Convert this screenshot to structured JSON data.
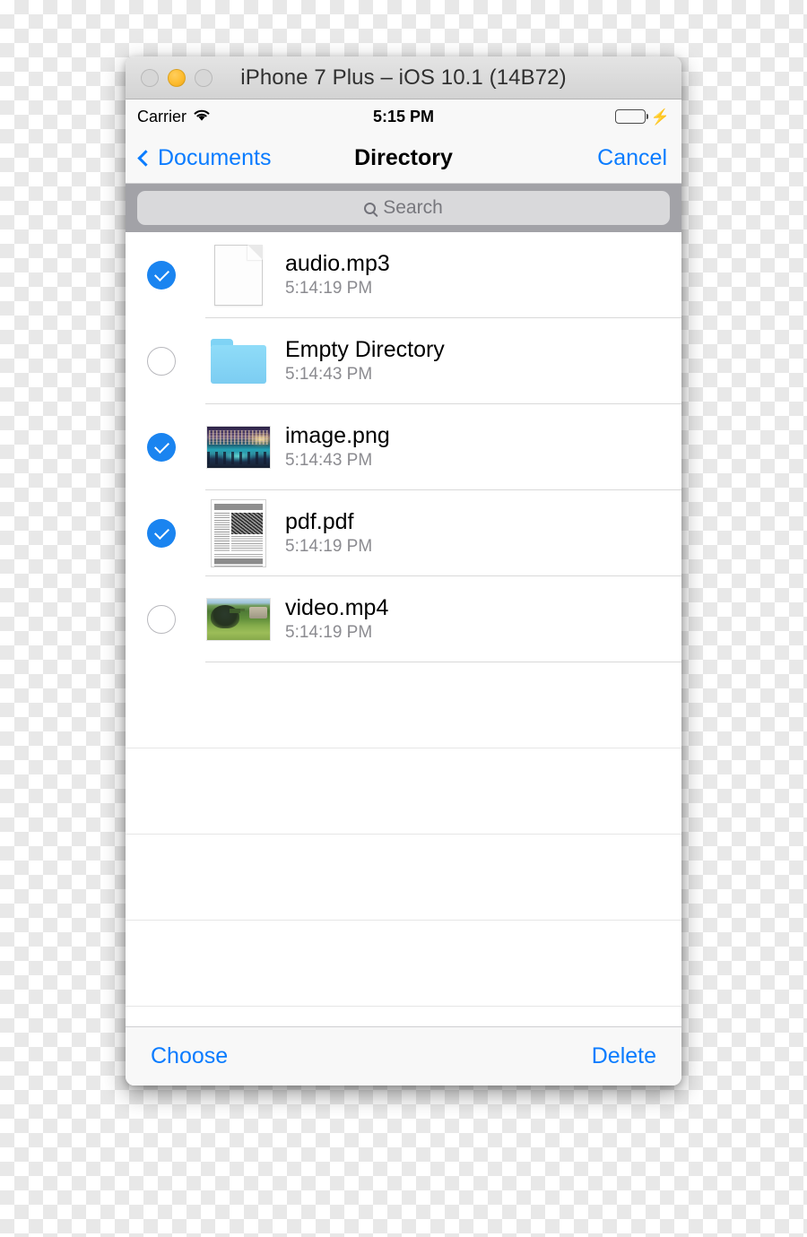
{
  "window": {
    "title": "iPhone 7 Plus – iOS 10.1 (14B72)",
    "traffic_lights": [
      "close",
      "minimize",
      "zoom"
    ]
  },
  "status_bar": {
    "carrier": "Carrier",
    "wifi_icon": "wifi-icon",
    "time": "5:15 PM",
    "battery_icon": "battery-full-icon",
    "charging_icon": "lightning-bolt-icon"
  },
  "nav_bar": {
    "back_icon": "chevron-left-icon",
    "back_label": "Documents",
    "title": "Directory",
    "cancel_label": "Cancel"
  },
  "search": {
    "icon": "search-icon",
    "placeholder": "Search",
    "value": ""
  },
  "files": [
    {
      "name": "audio.mp3",
      "date": "5:14:19 PM",
      "selected": true,
      "icon": "blank-document-icon",
      "kind": "doc"
    },
    {
      "name": "Empty Directory",
      "date": "5:14:43 PM",
      "selected": false,
      "icon": "folder-icon",
      "kind": "folder"
    },
    {
      "name": "image.png",
      "date": "5:14:43 PM",
      "selected": true,
      "icon": "image-thumbnail",
      "kind": "city-photo"
    },
    {
      "name": "pdf.pdf",
      "date": "5:14:19 PM",
      "selected": true,
      "icon": "pdf-thumbnail",
      "kind": "pdf"
    },
    {
      "name": "video.mp4",
      "date": "5:14:19 PM",
      "selected": false,
      "icon": "video-thumbnail",
      "kind": "nature-photo"
    }
  ],
  "empty_row_count": 4,
  "toolbar": {
    "choose_label": "Choose",
    "delete_label": "Delete"
  },
  "colors": {
    "tint_blue": "#0a7cff",
    "checkbox_blue": "#1a84f0",
    "battery_green": "#4cd964",
    "folder_blue": "#8fdcf8",
    "search_bar_gray": "#a2a2a7",
    "search_field_gray": "#d9d9db",
    "bar_background": "#f8f8f8",
    "secondary_text": "#8b8b90"
  }
}
